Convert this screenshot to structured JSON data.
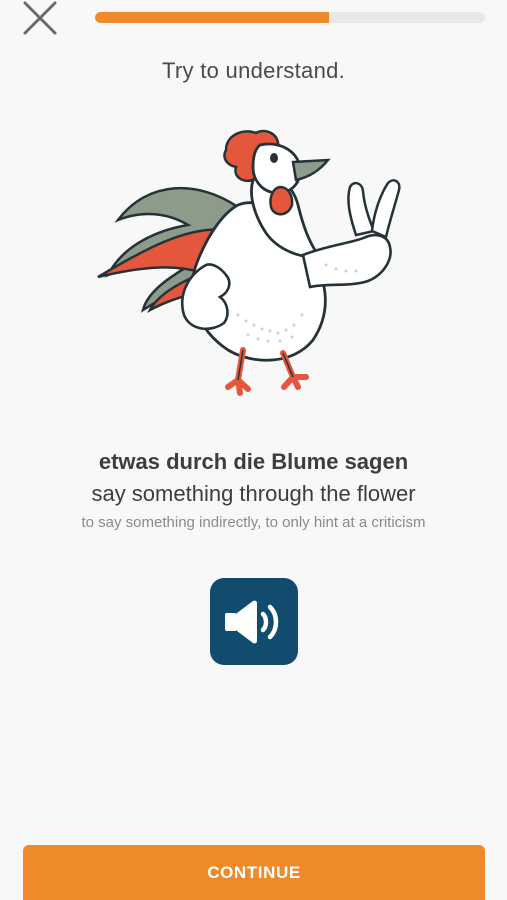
{
  "header": {
    "close_icon": "close-icon",
    "progress": 0.6
  },
  "instruction": "Try to understand.",
  "illustration": {
    "icon": "rooster-peace-sign-illustration"
  },
  "phrase": {
    "german": "etwas durch die Blume sagen",
    "literal": "say something through the flower",
    "meaning": "to say something indirectly, to only hint at a criticism"
  },
  "audio_button": {
    "icon": "speaker-icon"
  },
  "footer": {
    "continue_label": "CONTINUE"
  },
  "colors": {
    "accent": "#ee8a2a",
    "audio_button": "#114b6e",
    "background": "#f8f8f8",
    "rooster_red": "#e4573d",
    "rooster_green": "#8c9b8a"
  }
}
